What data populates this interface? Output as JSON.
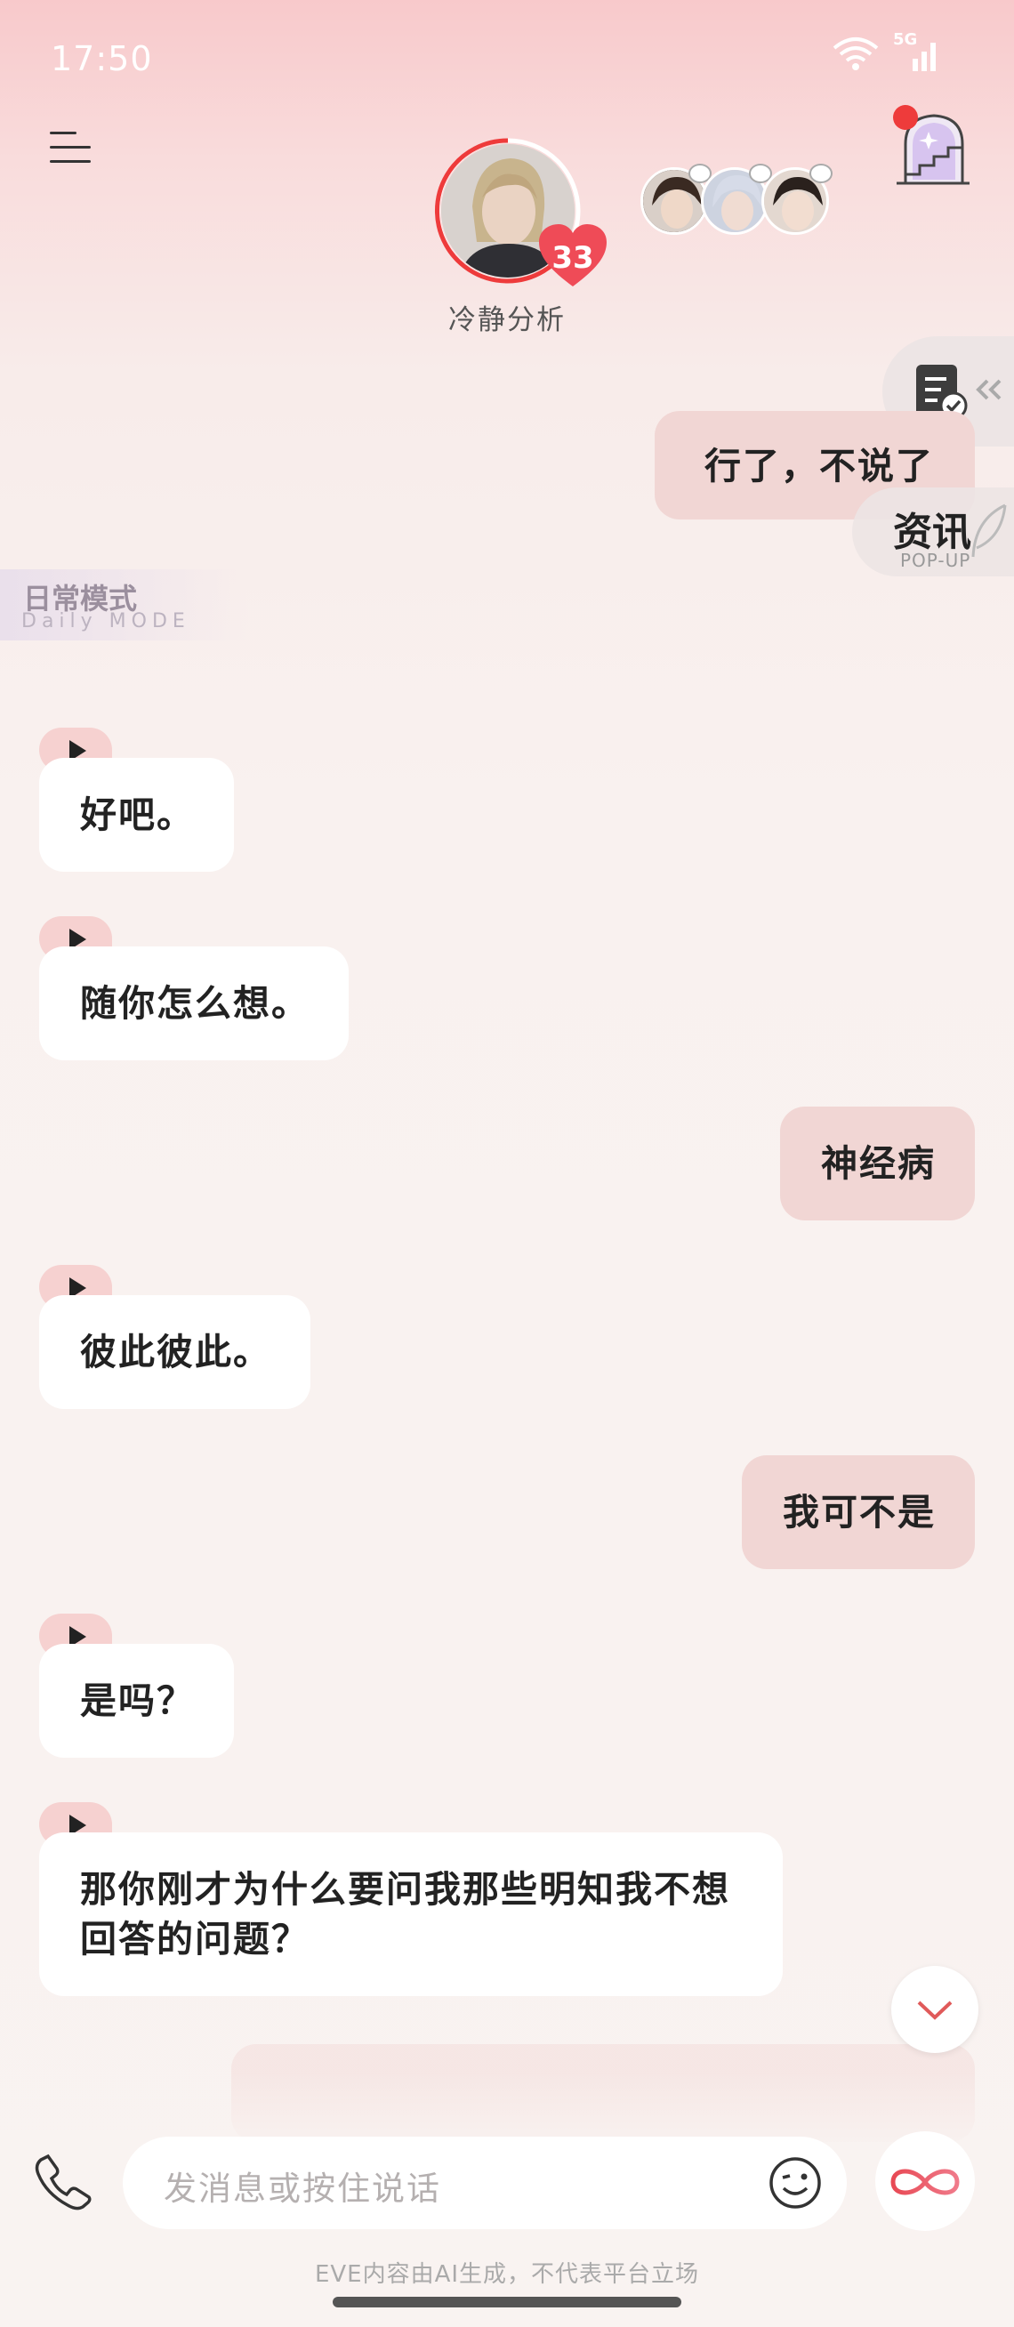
{
  "status_bar": {
    "time": "17:50",
    "network": "5G"
  },
  "header": {
    "character_name": "冷静分析",
    "character_subtitle": "",
    "affection_level": "33"
  },
  "side_tabs": {
    "news_title": "资讯",
    "news_subtitle": "POP-UP"
  },
  "mode": {
    "title": "日常模式",
    "subtitle": "Daily MODE"
  },
  "messages": [
    {
      "from": "user",
      "text": "行了，不说了"
    },
    {
      "from": "ai",
      "text": "好吧。"
    },
    {
      "from": "ai",
      "text": "随你怎么想。"
    },
    {
      "from": "user",
      "text": "神经病"
    },
    {
      "from": "ai",
      "text": "彼此彼此。"
    },
    {
      "from": "user",
      "text": "我可不是"
    },
    {
      "from": "ai",
      "text": "是吗？"
    },
    {
      "from": "ai",
      "text": "那你刚才为什么要问我那些明知我不想回答的问题？"
    }
  ],
  "input": {
    "placeholder": "发消息或按住说话"
  },
  "disclaimer": "EVE内容由AI生成，不代表平台立场",
  "colors": {
    "accent": "#ee3b3b",
    "user_bubble": "#f1d6d4",
    "ai_bubble": "#ffffff",
    "play_chip": "#f6d1d0"
  }
}
